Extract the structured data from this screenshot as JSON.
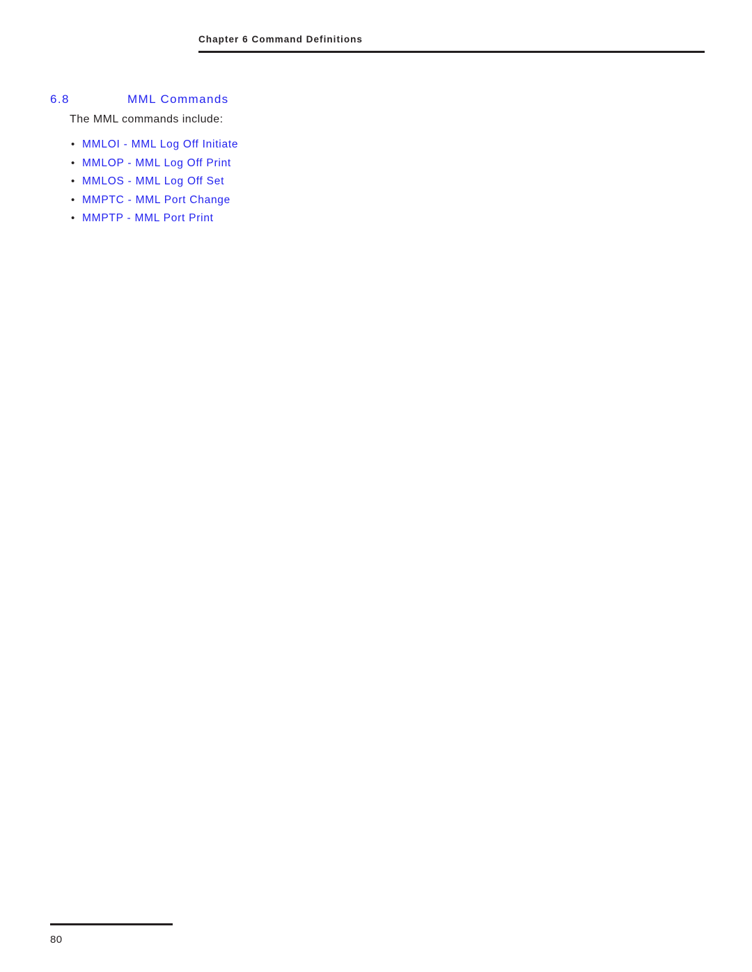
{
  "page": {
    "background_color": "#ffffff",
    "text_color": "#231f20",
    "link_color": "#2222ee"
  },
  "header": {
    "running_head": "Chapter 6 Command Definitions"
  },
  "section": {
    "number": "6.8",
    "title": "MML Commands",
    "intro": "The MML commands include:",
    "bullet_glyph": "•"
  },
  "commands": [
    {
      "label": "MMLOI - MML Log Off Initiate"
    },
    {
      "label": "MMLOP - MML Log Off Print"
    },
    {
      "label": "MMLOS - MML Log Off Set"
    },
    {
      "label": "MMPTC - MML Port Change"
    },
    {
      "label": "MMPTP - MML Port Print"
    }
  ],
  "footer": {
    "page_number": "80"
  }
}
